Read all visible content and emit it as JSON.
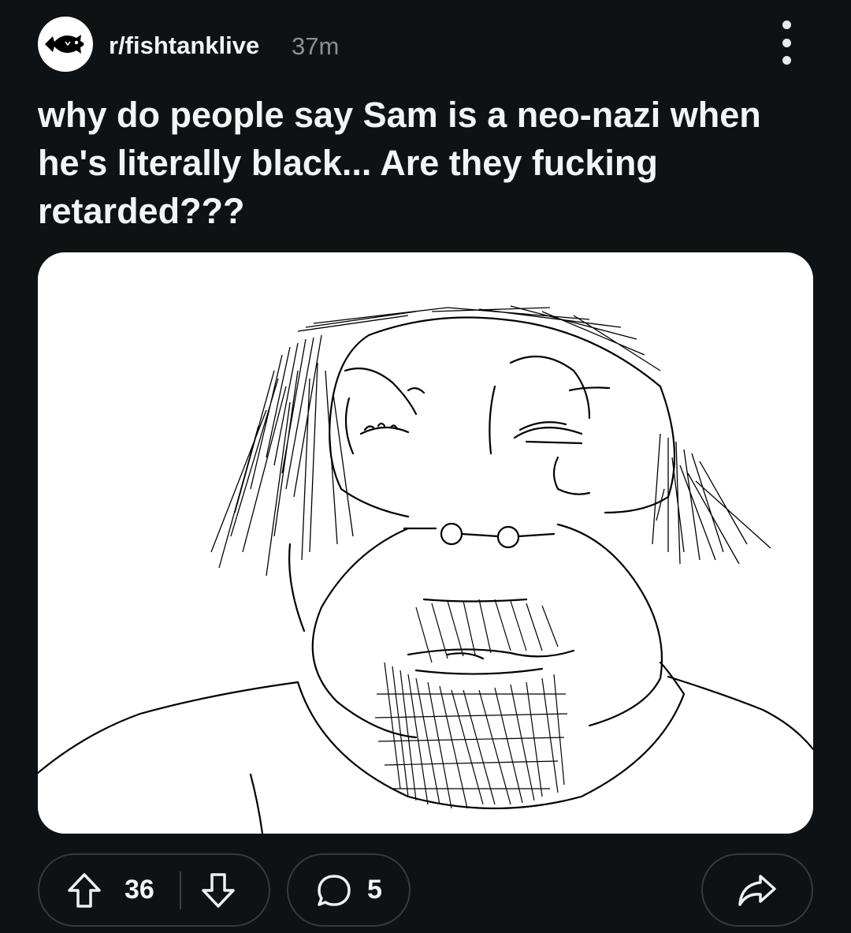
{
  "post": {
    "subreddit": "r/fishtanklive",
    "age": "37m",
    "title": "why do people say Sam is a neo-nazi when he's literally black... Are they fucking retarded???",
    "avatar_icon": "fish-logo-icon",
    "more_icon": "more-options-icon"
  },
  "actions": {
    "upvote_icon": "upvote-arrow-icon",
    "score": "36",
    "downvote_icon": "downvote-arrow-icon",
    "comment_icon": "comment-bubble-icon",
    "comment_count": "5",
    "share_icon": "share-arrow-icon"
  },
  "colors": {
    "background": "#0f1214",
    "text": "#f2f4f5",
    "muted": "#8a9095",
    "pill_border": "#343a3f",
    "image_background": "#ffffff"
  }
}
